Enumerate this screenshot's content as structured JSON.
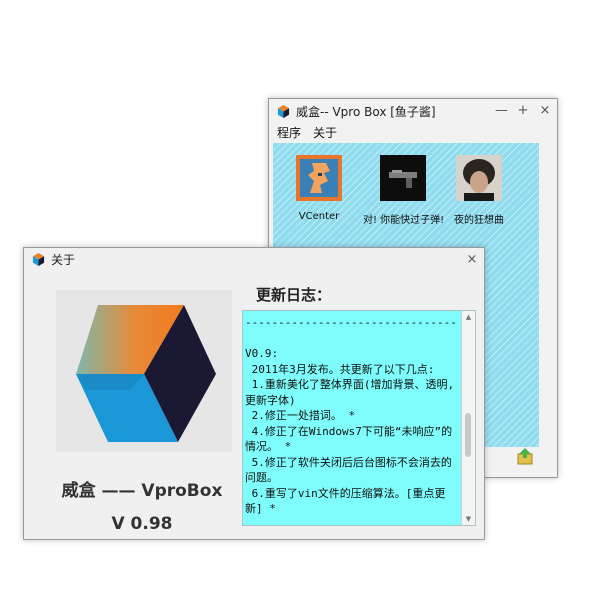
{
  "main_window": {
    "title": "威盒-- Vpro Box [鱼子酱]",
    "buttons": {
      "minimize": "—",
      "pin": "+",
      "close": "×"
    },
    "menu": [
      {
        "label": "程序"
      },
      {
        "label": "关于"
      }
    ],
    "tiles": [
      {
        "label": "VCenter",
        "icon": "vcenter-icon"
      },
      {
        "label": "对! 你能快过子弹!",
        "icon": "gun-thumbnail"
      },
      {
        "label": "夜的狂想曲",
        "icon": "portrait-thumbnail"
      }
    ],
    "background_color": "#8fdcef"
  },
  "about_window": {
    "title": "关于",
    "close": "×",
    "brand": "威盒 —— VproBox",
    "version": "V 0.98",
    "log_heading": "更新日志：",
    "log_text": "--------------------------------\n\nV0.9:\n 2011年3月发布。共更新了以下几点:\n 1.重新美化了整体界面(增加背景、透明,更新字体)\n 2.修正一处措词。 *\n 4.修正了在Windows7下可能“未响应”的情况。 *\n 5.修正了软件关闭后后台图标不会消去的问题。\n 6.重写了vin文件的压缩算法。[重点更新] *",
    "log_background": "#7ffcfc"
  }
}
